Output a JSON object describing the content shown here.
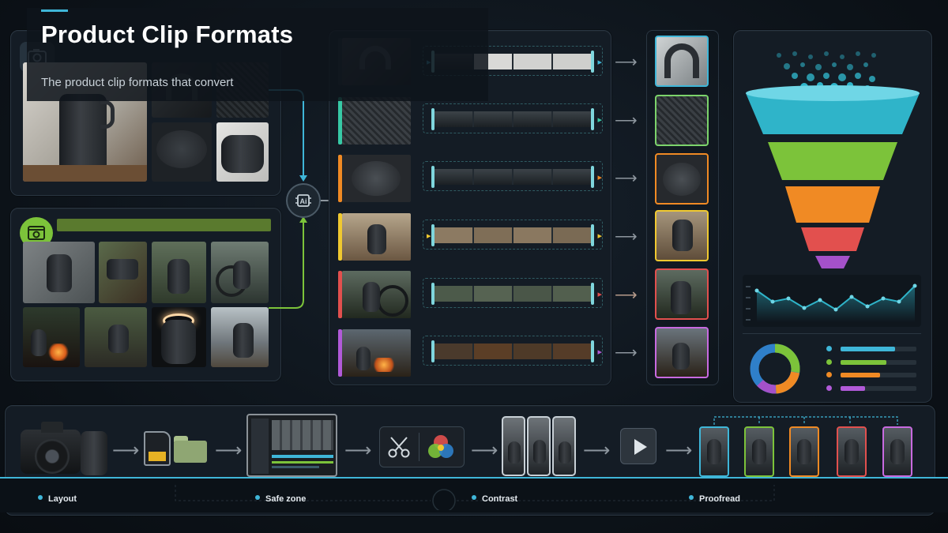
{
  "header": {
    "title": "Product Clip Formats",
    "subtitle": "The product clip formats that convert",
    "accent_color": "#3fb6d8"
  },
  "source_panels": {
    "studio": {
      "icon": "camera-icon"
    },
    "lifestyle": {
      "icon": "photo-folder-icon",
      "banner_color": "#5a7a2e"
    }
  },
  "pipeline": {
    "merge_icon": "ai-process-icon",
    "rows": [
      {
        "accent": "#1f2a33",
        "output_border": "#3fb6d8"
      },
      {
        "accent": "#37c9a6",
        "output_border": "#7cd36b"
      },
      {
        "accent": "#f08a24",
        "output_border": "#f08a24"
      },
      {
        "accent": "#f0c930",
        "output_border": "#f0c930"
      },
      {
        "accent": "#e2504e",
        "output_border": "#e2504e"
      },
      {
        "accent": "#b15ad8",
        "output_border": "#c86ae0"
      }
    ]
  },
  "funnel": {
    "layers": [
      "#2fb4c9",
      "#7cc33a",
      "#f08a24",
      "#e2504e",
      "#a451c9"
    ],
    "chart_icon": "line-chart-icon",
    "donut_colors": [
      "#7cc33a",
      "#f08a24",
      "#a451c9",
      "#2f7fc9"
    ],
    "legend_colors": [
      "#3fb6d8",
      "#7cc33a",
      "#f08a24",
      "#b15ad8"
    ],
    "legend_levels": [
      0.72,
      0.6,
      0.52,
      0.32
    ]
  },
  "workflow": {
    "steps": [
      "camera",
      "sd-card-and-folder",
      "editing-monitor",
      "cut-and-color",
      "vertical-phones",
      "play",
      "final-variants"
    ]
  },
  "bottom_bar": {
    "items": [
      "Layout",
      "Safe zone",
      "Contrast",
      "Proofread"
    ]
  }
}
